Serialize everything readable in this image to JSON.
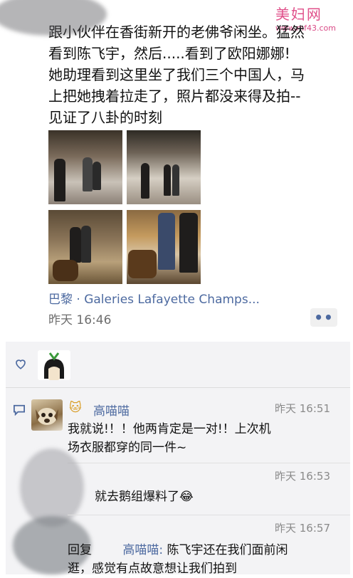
{
  "watermark": {
    "brand": "美妇网",
    "url": "www.mf43.com"
  },
  "post": {
    "text_lines": [
      "跟小伙伴在香街新开的老佛爷闲坐。猛然",
      "看到陈飞宇，然后.....看到了欧阳娜娜!",
      "她助理看到这里坐了我们三个中国人，马",
      "上把她拽着拉走了，照片都没来得及拍--",
      "见证了八卦的时刻"
    ],
    "location": "巴黎 · Galeries Lafayette Champs...",
    "time": "昨天 16:46",
    "more_label": "••"
  },
  "feedback": {
    "comments": [
      {
        "name": "高喵喵",
        "name_icon": "🐱",
        "time": "昨天 16:51",
        "lines": [
          "我就说!！！他两肯定是一对!！上次机",
          "场衣服都穿的同一件~"
        ]
      },
      {
        "name": "",
        "time": "昨天 16:53",
        "lines": [
          "就去鹅组爆料了😂"
        ]
      },
      {
        "reply_prefix": "回复",
        "reply_to": "高喵喵:",
        "time": "昨天 16:57",
        "lines": [
          "陈飞宇还在我们面前闲",
          "逛，感觉有点故意想让我们拍到"
        ]
      }
    ]
  },
  "colors": {
    "accent": "#4d6aa0",
    "watermark": "#e0508a"
  }
}
